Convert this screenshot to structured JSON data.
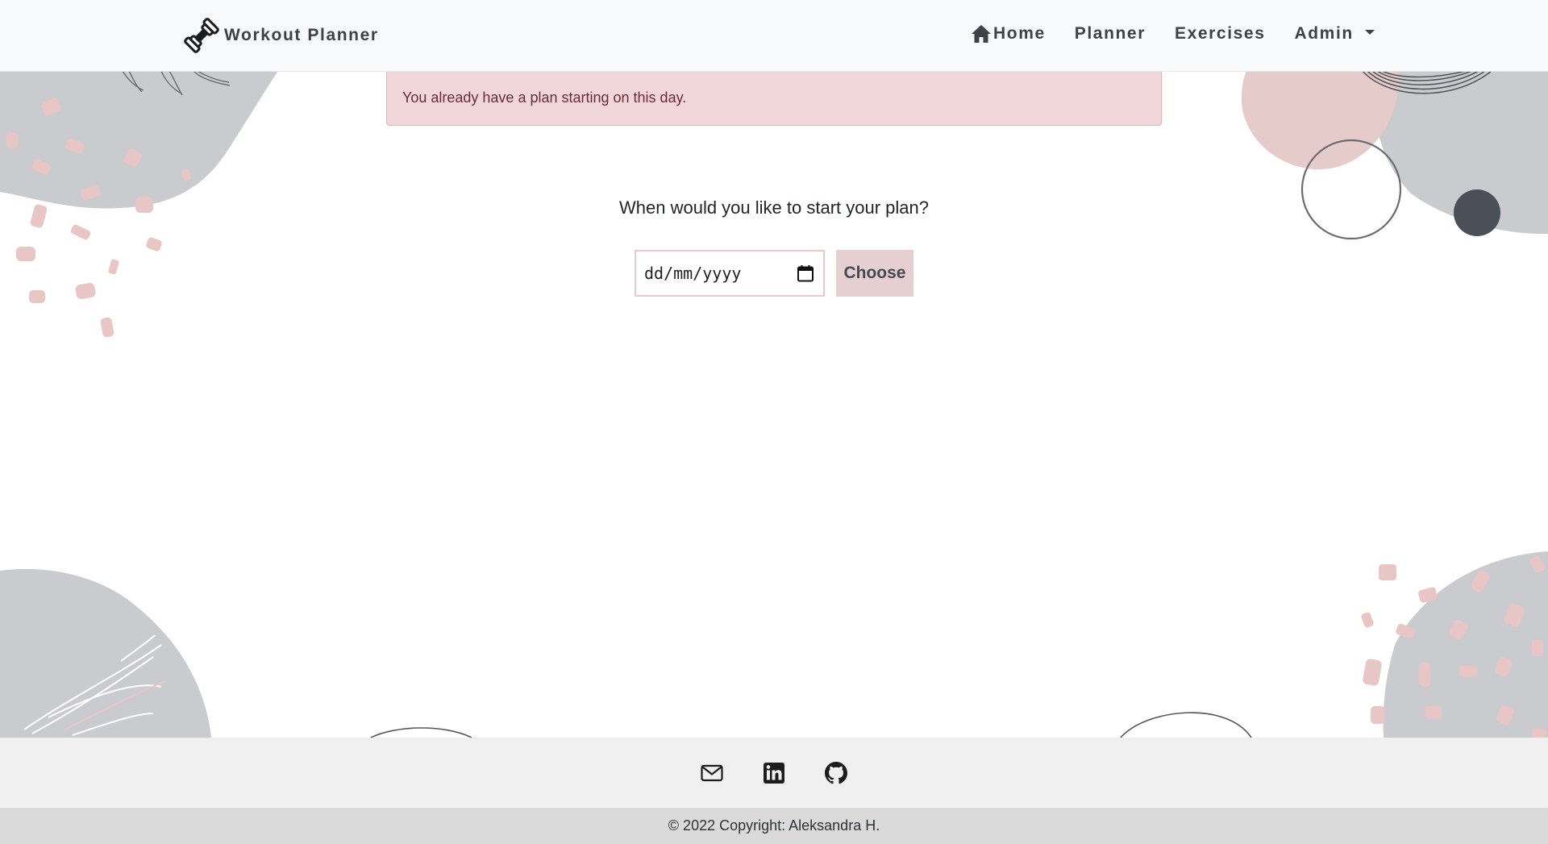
{
  "navbar": {
    "brand": "Workout Planner",
    "links": [
      {
        "label": "Home",
        "icon": "home-icon"
      },
      {
        "label": "Planner"
      },
      {
        "label": "Exercises"
      },
      {
        "label": "Admin",
        "dropdown": true
      }
    ]
  },
  "alert": {
    "message": "You already have a plan starting on this day.",
    "type": "danger"
  },
  "form": {
    "question": "When would you like to start your plan?",
    "date_placeholder": "dd/mm/yyyy",
    "date_value": "",
    "submit_label": "Choose"
  },
  "footer": {
    "icons": [
      "email-icon",
      "linkedin-icon",
      "github-icon"
    ],
    "copyright": "© 2022 Copyright: Aleksandra H."
  },
  "colors": {
    "navbar_bg": "#f8f9fa",
    "nav_text": "#3d4148",
    "alert_bg": "#f2d7da",
    "alert_text": "#6b2b33",
    "button_bg": "#e6cfd1",
    "footer_bg": "#f0f0f0",
    "copyright_bg": "#dadada",
    "blob_grey": "#cacbce",
    "blob_pink": "#e6cbcb"
  }
}
